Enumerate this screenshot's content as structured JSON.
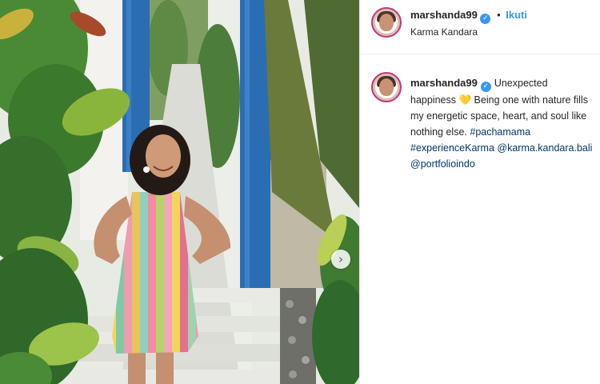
{
  "post": {
    "username": "marshanda99",
    "verified_glyph": "✓",
    "separator": "•",
    "follow_label": "Ikuti",
    "location": "Karma Kandara",
    "caption": {
      "username": "marshanda99",
      "text_1": "Unexpected happiness",
      "emoji": "💛",
      "text_2": "Being one with nature fills my energetic space, heart, and soul like nothing else.",
      "hashtag_1": "#pachamama",
      "hashtag_2": "#experienceKarma",
      "mention_1": "@karma.kandara.bali",
      "mention_2": "@portfolioindo"
    },
    "carousel_next_glyph": "›"
  },
  "colors": {
    "link_blue": "#3897f0",
    "tag_navy": "#00376b",
    "text": "#262626",
    "door_blue": "#2b6db3"
  }
}
